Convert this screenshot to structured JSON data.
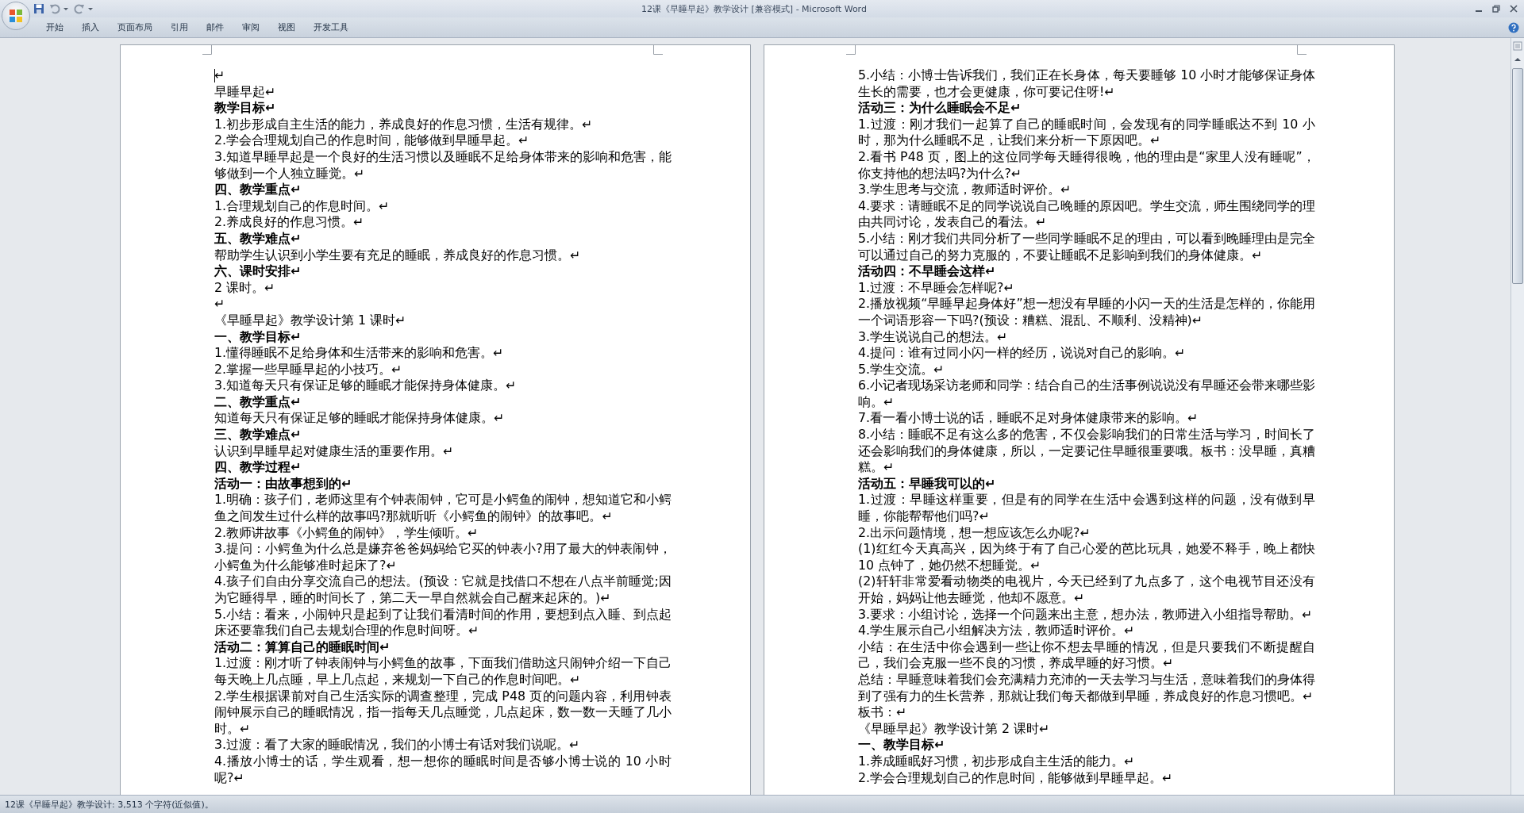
{
  "window": {
    "title": "12课《早睡早起》教学设计 [兼容模式] - Microsoft Word"
  },
  "ribbon_tabs": [
    {
      "label": "开始"
    },
    {
      "label": "插入"
    },
    {
      "label": "页面布局"
    },
    {
      "label": "引用"
    },
    {
      "label": "邮件"
    },
    {
      "label": "审阅"
    },
    {
      "label": "视图"
    },
    {
      "label": "开发工具"
    }
  ],
  "pages": [
    {
      "paragraphs": [
        {
          "text": "↵",
          "cursor": true
        },
        {
          "text": "早睡早起↵"
        },
        {
          "text": "教学目标↵",
          "bold": true
        },
        {
          "text": "1.初步形成自主生活的能力，养成良好的作息习惯，生活有规律。↵"
        },
        {
          "text": "2.学会合理规划自己的作息时间，能够做到早睡早起。↵"
        },
        {
          "text": "3.知道早睡早起是一个良好的生活习惯以及睡眠不足给身体带来的影响和危害，能够做到一个人独立睡觉。↵"
        },
        {
          "text": "四、教学重点↵",
          "bold": true
        },
        {
          "text": "1.合理规划自己的作息时间。↵"
        },
        {
          "text": "2.养成良好的作息习惯。↵"
        },
        {
          "text": "五、教学难点↵",
          "bold": true
        },
        {
          "text": "帮助学生认识到小学生要有充足的睡眠，养成良好的作息习惯。↵"
        },
        {
          "text": "六、课时安排↵",
          "bold": true
        },
        {
          "text": "2 课时。↵"
        },
        {
          "text": "↵"
        },
        {
          "text": "《早睡早起》教学设计第 1 课时↵"
        },
        {
          "text": "一、教学目标↵",
          "bold": true
        },
        {
          "text": "1.懂得睡眠不足给身体和生活带来的影响和危害。↵"
        },
        {
          "text": "2.掌握一些早睡早起的小技巧。↵"
        },
        {
          "text": "3.知道每天只有保证足够的睡眠才能保持身体健康。↵"
        },
        {
          "text": "二、教学重点↵",
          "bold": true
        },
        {
          "text": "知道每天只有保证足够的睡眠才能保持身体健康。↵"
        },
        {
          "text": "三、教学难点↵",
          "bold": true
        },
        {
          "text": "认识到早睡早起对健康生活的重要作用。↵"
        },
        {
          "text": "四、教学过程↵",
          "bold": true
        },
        {
          "text": "活动一：由故事想到的↵",
          "bold": true
        },
        {
          "text": "1.明确：孩子们，老师这里有个钟表闹钟，它可是小鳄鱼的闹钟，想知道它和小鳄鱼之间发生过什么样的故事吗?那就听听《小鳄鱼的闹钟》的故事吧。↵"
        },
        {
          "text": "2.教师讲故事《小鳄鱼的闹钟》，学生倾听。↵"
        },
        {
          "text": "3.提问：小鳄鱼为什么总是嫌弃爸爸妈妈给它买的钟表小?用了最大的钟表闹钟，小鳄鱼为什么能够准时起床了?↵"
        },
        {
          "text": "4.孩子们自由分享交流自己的想法。(预设：它就是找借口不想在八点半前睡觉;因为它睡得早，睡的时间长了，第二天一早自然就会自己醒来起床的。)↵"
        },
        {
          "text": "5.小结：看来，小闹钟只是起到了让我们看清时间的作用，要想到点入睡、到点起床还要靠我们自己去规划合理的作息时间呀。↵"
        },
        {
          "text": "活动二：算算自己的睡眠时间↵",
          "bold": true
        },
        {
          "text": "1.过渡：刚才听了钟表闹钟与小鳄鱼的故事，下面我们借助这只闹钟介绍一下自己每天晚上几点睡，早上几点起，来规划一下自己的作息时间吧。↵"
        },
        {
          "text": "2.学生根据课前对自己生活实际的调查整理，完成 P48 页的问题内容，利用钟表闹钟展示自己的睡眠情况，指一指每天几点睡觉，几点起床，数一数一天睡了几小时。↵"
        },
        {
          "text": "3.过渡：看了大家的睡眠情况，我们的小博士有话对我们说呢。↵"
        },
        {
          "text": "4.播放小博士的话，学生观看，想一想你的睡眠时间是否够小博士说的 10 小时呢?↵"
        }
      ]
    },
    {
      "paragraphs": [
        {
          "text": "5.小结：小博士告诉我们，我们正在长身体，每天要睡够 10 小时才能够保证身体生长的需要，也才会更健康，你可要记住呀!↵"
        },
        {
          "text": "活动三：为什么睡眠会不足↵",
          "bold": true
        },
        {
          "text": "1.过渡：刚才我们一起算了自己的睡眠时间，会发现有的同学睡眠达不到 10 小时，那为什么睡眠不足，让我们来分析一下原因吧。↵"
        },
        {
          "text": "2.看书 P48 页，图上的这位同学每天睡得很晚，他的理由是“家里人没有睡呢”，你支持他的想法吗?为什么?↵"
        },
        {
          "text": "3.学生思考与交流，教师适时评价。↵"
        },
        {
          "text": "4.要求：请睡眠不足的同学说说自己晚睡的原因吧。学生交流，师生围绕同学的理由共同讨论，发表自己的看法。↵"
        },
        {
          "text": "5.小结：刚才我们共同分析了一些同学睡眠不足的理由，可以看到晚睡理由是完全可以通过自己的努力克服的，不要让睡眠不足影响到我们的身体健康。↵"
        },
        {
          "text": "活动四：不早睡会这样↵",
          "bold": true
        },
        {
          "text": "1.过渡：不早睡会怎样呢?↵"
        },
        {
          "text": "2.播放视频“早睡早起身体好”想一想没有早睡的小闪一天的生活是怎样的，你能用一个词语形容一下吗?(预设：糟糕、混乱、不顺利、没精神)↵"
        },
        {
          "text": "3.学生说说自己的想法。↵"
        },
        {
          "text": "4.提问：谁有过同小闪一样的经历，说说对自己的影响。↵"
        },
        {
          "text": "5.学生交流。↵"
        },
        {
          "text": "6.小记者现场采访老师和同学：结合自己的生活事例说说没有早睡还会带来哪些影响。↵"
        },
        {
          "text": "7.看一看小博士说的话，睡眠不足对身体健康带来的影响。↵"
        },
        {
          "text": "8.小结：睡眠不足有这么多的危害，不仅会影响我们的日常生活与学习，时间长了还会影响我们的身体健康，所以，一定要记住早睡很重要哦。板书：没早睡，真糟糕。↵"
        },
        {
          "text": "活动五：早睡我可以的↵",
          "bold": true
        },
        {
          "text": "1.过渡：早睡这样重要，但是有的同学在生活中会遇到这样的问题，没有做到早睡，你能帮帮他们吗?↵"
        },
        {
          "text": "2.出示问题情境，想一想应该怎么办呢?↵"
        },
        {
          "text": "(1)红红今天真高兴，因为终于有了自己心爱的芭比玩具，她爱不释手，晚上都快 10 点钟了，她仍然不想睡觉。↵"
        },
        {
          "text": "(2)轩轩非常爱看动物类的电视片，今天已经到了九点多了，这个电视节目还没有开始，妈妈让他去睡觉，他却不愿意。↵"
        },
        {
          "text": "3.要求：小组讨论，选择一个问题来出主意，想办法，教师进入小组指导帮助。↵"
        },
        {
          "text": "4.学生展示自己小组解决方法，教师适时评价。↵"
        },
        {
          "text": "小结：在生活中你会遇到一些让你不想去早睡的情况，但是只要我们不断提醒自己，我们会克服一些不良的习惯，养成早睡的好习惯。↵"
        },
        {
          "text": "总结：早睡意味着我们会充满精力充沛的一天去学习与生活，意味着我们的身体得到了强有力的生长营养，那就让我们每天都做到早睡，养成良好的作息习惯吧。↵"
        },
        {
          "text": "板书：↵"
        },
        {
          "text": "《早睡早起》教学设计第 2 课时↵"
        },
        {
          "text": "一、教学目标↵",
          "bold": true
        },
        {
          "text": "1.养成睡眠好习惯，初步形成自主生活的能力。↵"
        },
        {
          "text": "2.学会合理规划自己的作息时间，能够做到早睡早起。↵"
        }
      ]
    }
  ],
  "status_bar": {
    "text": "12课《早睡早起》教学设计: 3,513 个字符(近似值)。"
  }
}
